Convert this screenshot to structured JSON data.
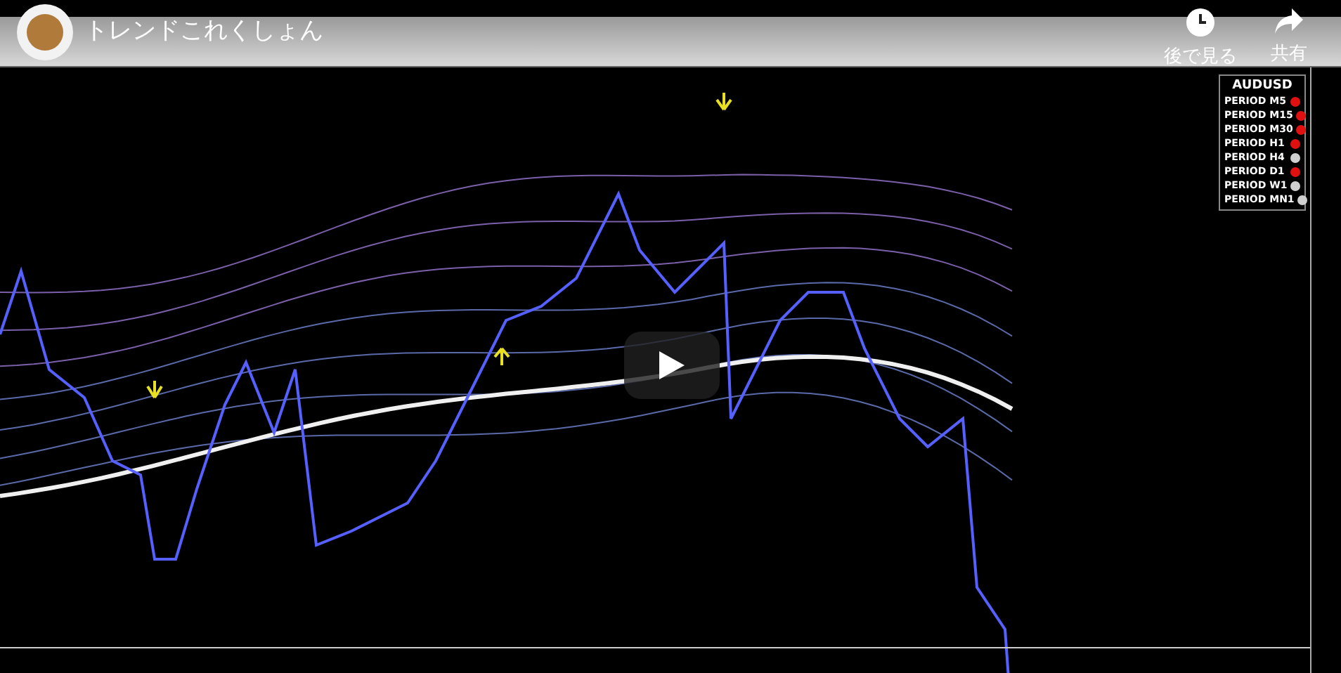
{
  "video": {
    "title": "トレンドこれくしょん",
    "actions": [
      {
        "kind": "watch_later",
        "label": "後で見る"
      },
      {
        "kind": "share",
        "label": "共有"
      }
    ]
  },
  "legend": {
    "symbol": "AUDUSD",
    "periods": [
      {
        "label": "PERIOD M5",
        "color": "#e01010"
      },
      {
        "label": "PERIOD M15",
        "color": "#e01010"
      },
      {
        "label": "PERIOD M30",
        "color": "#e01010"
      },
      {
        "label": "PERIOD H1",
        "color": "#e01010"
      },
      {
        "label": "PERIOD H4",
        "color": "#d0d0d0"
      },
      {
        "label": "PERIOD D1",
        "color": "#e01010"
      },
      {
        "label": "PERIOD W1",
        "color": "#d0d0d0"
      },
      {
        "label": "PERIOD MN1",
        "color": "#d0d0d0"
      }
    ]
  }
}
